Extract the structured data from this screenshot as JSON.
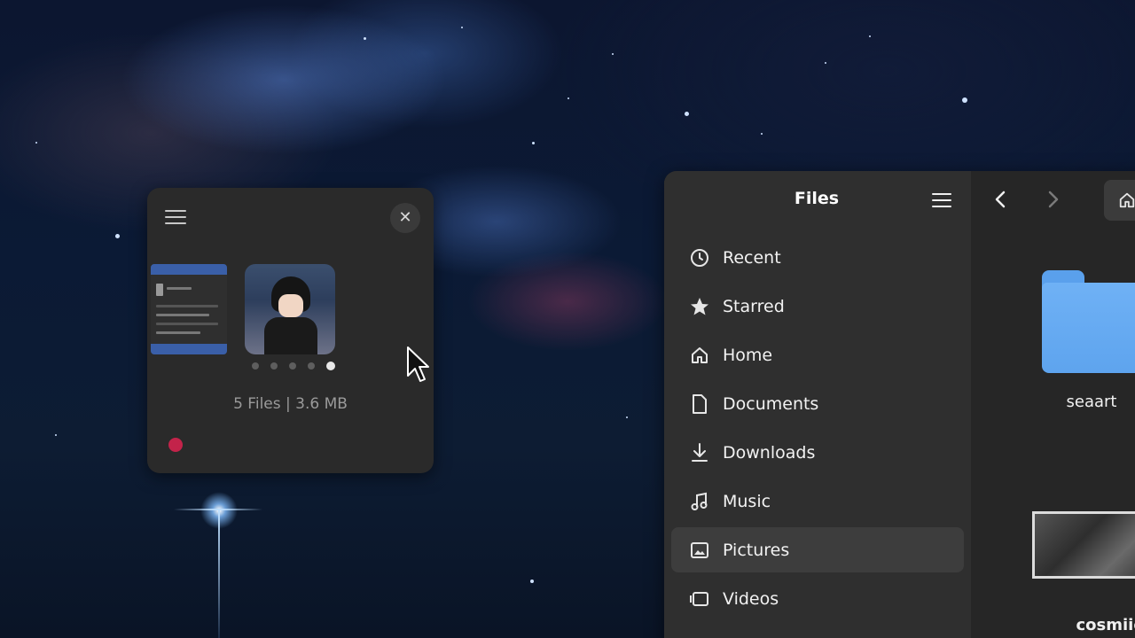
{
  "widget": {
    "info": "5 Files | 3.6 MB",
    "pager": [
      false,
      false,
      false,
      false,
      true
    ],
    "colors": {
      "record": "#c3234a",
      "panel": "#2a2a2a"
    }
  },
  "files_window": {
    "title": "Files",
    "sidebar": [
      {
        "label": "Recent",
        "icon": "clock-icon"
      },
      {
        "label": "Starred",
        "icon": "star-icon"
      },
      {
        "label": "Home",
        "icon": "home-icon"
      },
      {
        "label": "Documents",
        "icon": "document-icon"
      },
      {
        "label": "Downloads",
        "icon": "download-icon"
      },
      {
        "label": "Music",
        "icon": "music-icon"
      },
      {
        "label": "Pictures",
        "icon": "pictures-icon",
        "selected": true
      },
      {
        "label": "Videos",
        "icon": "videos-icon"
      }
    ],
    "items": [
      {
        "label": "seaart",
        "icon": "folder-icon"
      },
      {
        "label": "cosmiic-",
        "icon": "image-thumbnail"
      }
    ],
    "colors": {
      "folder": "#6fb1f5",
      "sidebar": "#2f2f2f",
      "content": "#262626"
    }
  }
}
